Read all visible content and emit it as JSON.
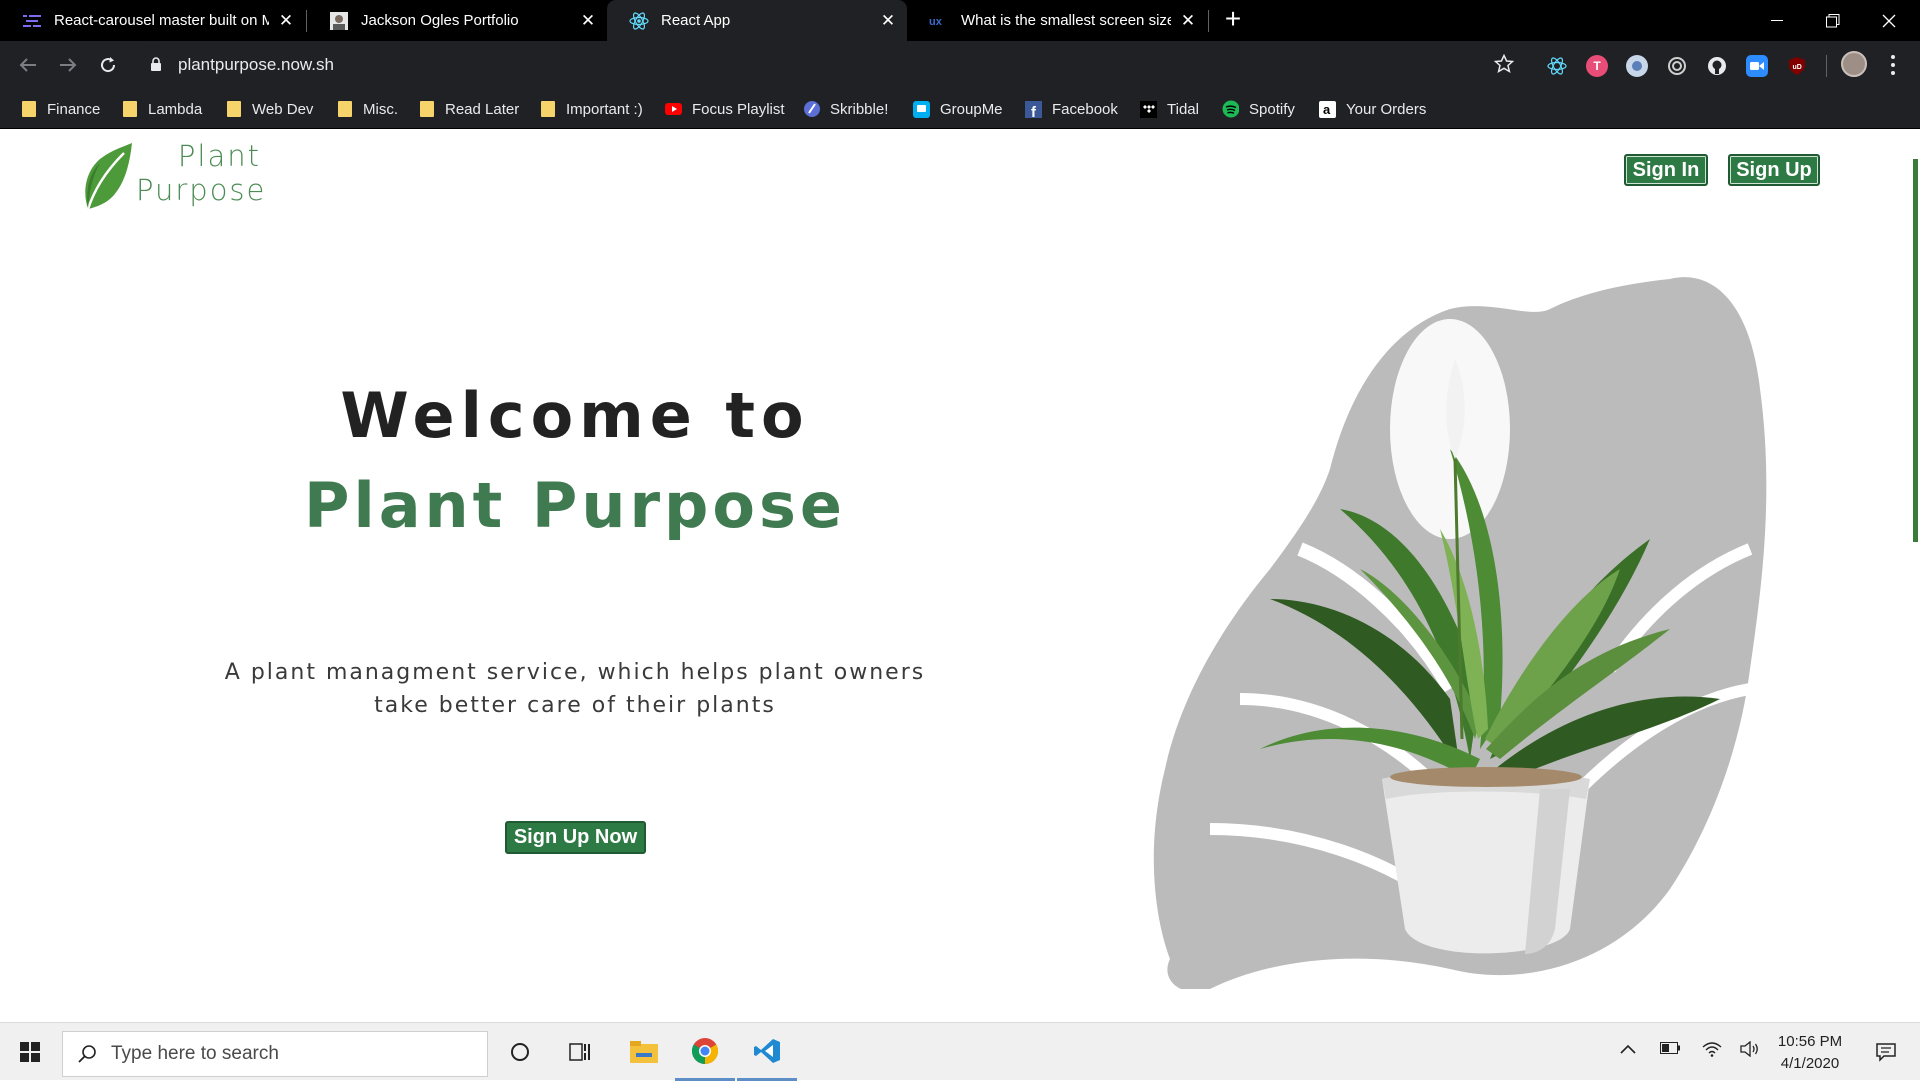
{
  "browser": {
    "tabs": [
      {
        "title": "React-carousel master built on M",
        "favicon": "carousel-icon",
        "active": false
      },
      {
        "title": "Jackson Ogles Portfolio",
        "favicon": "portfolio-avatar-icon",
        "active": false
      },
      {
        "title": "React App",
        "favicon": "react-icon",
        "active": true
      },
      {
        "title": "What is the smallest screen size y",
        "favicon": "ux-icon",
        "active": false
      }
    ],
    "url": "plantpurpose.now.sh",
    "bookmarks": [
      {
        "label": "Finance",
        "icon": "folder-icon"
      },
      {
        "label": "Lambda",
        "icon": "folder-icon"
      },
      {
        "label": "Web Dev",
        "icon": "folder-icon"
      },
      {
        "label": "Misc.",
        "icon": "folder-icon"
      },
      {
        "label": "Read Later",
        "icon": "folder-icon"
      },
      {
        "label": "Important :)",
        "icon": "folder-icon"
      },
      {
        "label": "Focus Playlist",
        "icon": "youtube-icon"
      },
      {
        "label": "Skribble!",
        "icon": "skribble-icon"
      },
      {
        "label": "GroupMe",
        "icon": "groupme-icon"
      },
      {
        "label": "Facebook",
        "icon": "facebook-icon"
      },
      {
        "label": "Tidal",
        "icon": "tidal-icon"
      },
      {
        "label": "Spotify",
        "icon": "spotify-icon"
      },
      {
        "label": "Your Orders",
        "icon": "amazon-icon"
      }
    ]
  },
  "site": {
    "logo_line1": "Plant",
    "logo_line2": "Purpose",
    "sign_in": "Sign In",
    "sign_up": "Sign Up",
    "hero_line1": "Welcome to",
    "hero_line2": "Plant Purpose",
    "description_line1": "A plant managment service, which helps plant owners",
    "description_line2": "take better care of their plants",
    "cta": "Sign Up Now",
    "colors": {
      "brand_green": "#2e7a45",
      "heading_green": "#3f7a51"
    }
  },
  "taskbar": {
    "search_placeholder": "Type here to search",
    "time": "10:56 PM",
    "date": "4/1/2020"
  }
}
